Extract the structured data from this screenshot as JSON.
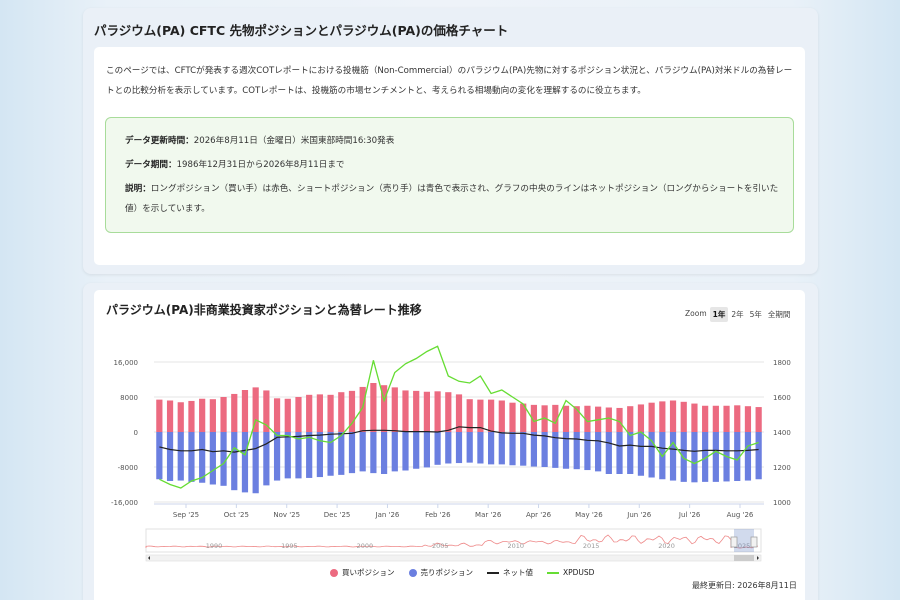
{
  "section1": {
    "title": "パラジウム(PA) CFTC 先物ポジションとパラジウム(PA)の価格チャート",
    "intro": "このページでは、CFTCが発表する週次COTレポートにおける投機筋（Non-Commercial）のパラジウム(PA)先物に対するポジション状況と、パラジウム(PA)対米ドルの為替レートとの比較分析を表示しています。COTレポートは、投機筋の市場センチメントと、考えられる相場動向の変化を理解するのに役立ちます。",
    "update_label": "データ更新時間：",
    "update_value": "2026年8月11日（金曜日）米国東部時間16:30発表",
    "period_label": "データ期間：",
    "period_value": "1986年12月31日から2026年8月11日まで",
    "desc_label": "説明：",
    "desc_value": "ロングポジション（買い手）は赤色、ショートポジション（売り手）は青色で表示され、グラフの中央のラインはネットポジション（ロングからショートを引いた値）を示しています。"
  },
  "section2": {
    "title": "パラジウム(PA)非商業投資家ポジションと為替レート推移",
    "zoom_label": "Zoom",
    "zoom_options": [
      "1年",
      "2年",
      "5年",
      "全期間"
    ],
    "zoom_active": "1年",
    "legend": [
      "買いポジション",
      "売りポジション",
      "ネット値",
      "XPDUSD"
    ],
    "updated": "最終更新日: 2026年8月11日"
  },
  "colors": {
    "long": "#ec6a80",
    "short": "#6b7fe0",
    "net": "#222222",
    "price": "#66dd33"
  },
  "chart_data": {
    "type": "bar",
    "left_axis_ticks": [
      "16,000",
      "8000",
      "0",
      "-8000",
      "-16,000"
    ],
    "left_axis_range": [
      -16000,
      16000
    ],
    "right_axis_ticks": [
      "1800",
      "1600",
      "1400",
      "1200",
      "1000"
    ],
    "right_axis_range": [
      1000,
      1800
    ],
    "x_tick_labels": [
      "Sep '25",
      "Oct '25",
      "Nov '25",
      "Dec '25",
      "Jan '26",
      "Feb '26",
      "Mar '26",
      "Apr '26",
      "May '26",
      "Jun '26",
      "Jul '26",
      "Aug '26"
    ],
    "navigator_labels": [
      "1990",
      "1995",
      "2000",
      "2005",
      "2010",
      "2015",
      "2020",
      "2025"
    ],
    "series": [
      {
        "name": "買いポジション",
        "values": [
          7400,
          7200,
          6800,
          7100,
          7600,
          7500,
          8000,
          8700,
          9600,
          10200,
          9500,
          7700,
          7600,
          8000,
          8500,
          8600,
          8500,
          9100,
          9400,
          10300,
          11200,
          10700,
          10200,
          9500,
          9400,
          9200,
          9300,
          9100,
          8600,
          7500,
          7400,
          7400,
          7200,
          6700,
          6500,
          6200,
          6100,
          6200,
          6000,
          5900,
          6000,
          5800,
          5600,
          5500,
          5900,
          6300,
          6700,
          7000,
          7200,
          6900,
          6500,
          6000,
          6000,
          6000,
          6100,
          5900,
          5700
        ]
      },
      {
        "name": "売りポジション",
        "values": [
          -10800,
          -11200,
          -11100,
          -11400,
          -11600,
          -12000,
          -12300,
          -13300,
          -13800,
          -14000,
          -12200,
          -11100,
          -10600,
          -10600,
          -10500,
          -10300,
          -10000,
          -9800,
          -9400,
          -9000,
          -9400,
          -9600,
          -9000,
          -8800,
          -8400,
          -8100,
          -7500,
          -7200,
          -7100,
          -7000,
          -7200,
          -7400,
          -7400,
          -7600,
          -7700,
          -7900,
          -8000,
          -8200,
          -8400,
          -8500,
          -8700,
          -9000,
          -9600,
          -9600,
          -9600,
          -10000,
          -10400,
          -10800,
          -11100,
          -11400,
          -11500,
          -11400,
          -11400,
          -11300,
          -11200,
          -11100,
          -10800
        ]
      },
      {
        "name": "ネット値",
        "values": [
          -3400,
          -4000,
          -4300,
          -4300,
          -4000,
          -4500,
          -4300,
          -4600,
          -4200,
          -3800,
          -2700,
          -1200,
          -1100,
          -1000,
          -800,
          -700,
          -500,
          -400,
          -300,
          300,
          400,
          400,
          300,
          100,
          100,
          100,
          0,
          400,
          1200,
          1000,
          1000,
          200,
          -200,
          -300,
          -300,
          -700,
          -900,
          -1300,
          -1500,
          -1600,
          -1900,
          -2000,
          -2500,
          -3200,
          -3000,
          -3300,
          -3300,
          -3700,
          -3900,
          -4200,
          -4400,
          -4200,
          -4200,
          -4300,
          -4300,
          -4200,
          -4000
        ]
      },
      {
        "name": "XPDUSD",
        "values": [
          1130,
          1100,
          1080,
          1120,
          1140,
          1180,
          1220,
          1310,
          1270,
          1470,
          1440,
          1380,
          1380,
          1360,
          1370,
          1350,
          1340,
          1380,
          1450,
          1540,
          1810,
          1580,
          1740,
          1790,
          1820,
          1860,
          1890,
          1720,
          1690,
          1680,
          1720,
          1620,
          1640,
          1600,
          1560,
          1460,
          1480,
          1450,
          1580,
          1530,
          1460,
          1470,
          1480,
          1460,
          1380,
          1400,
          1350,
          1260,
          1340,
          1250,
          1220,
          1250,
          1290,
          1260,
          1240,
          1320,
          1340
        ]
      }
    ]
  }
}
